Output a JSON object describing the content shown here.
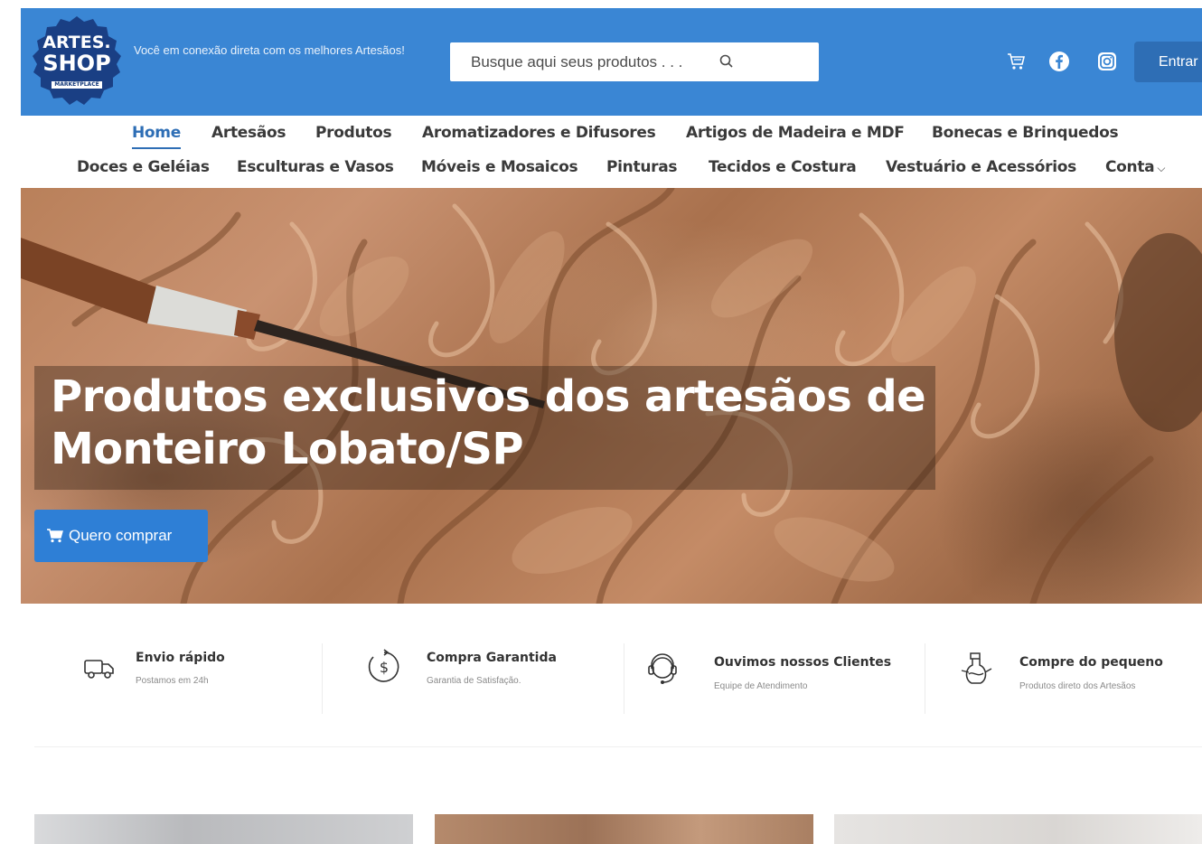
{
  "header": {
    "logo": {
      "line1": "ARTES.",
      "line2": "SHOP",
      "line3": "MARKETPLACE"
    },
    "tagline": "Você em conexão direta com os melhores Artesãos!",
    "search_placeholder": "Busque aqui seus produtos . . .",
    "login_label": "Entrar",
    "icons": [
      "cart-icon",
      "facebook-icon",
      "instagram-icon"
    ],
    "color": "#3a86d4"
  },
  "nav": {
    "row1": [
      "Home",
      "Artesãos",
      "Produtos",
      "Aromatizadores e Difusores",
      "Artigos de Madeira e MDF",
      "Bonecas e Brinquedos"
    ],
    "row2": [
      "Doces e Geléias",
      "Esculturas e Vasos",
      "Móveis e Mosaicos",
      "Pinturas",
      "Tecidos e Costura",
      "Vestuário e Acessórios",
      "Conta"
    ],
    "active": "Home",
    "accent": "#2e6eb5"
  },
  "hero": {
    "title": "Produtos exclusivos dos artesãos de Monteiro Lobato/SP",
    "cta_label": "Quero comprar",
    "cta_icon": "cart-icon"
  },
  "features": [
    {
      "title": "Envio rápido",
      "subtitle": "Postamos em 24h",
      "icon": "truck-icon"
    },
    {
      "title": "Compra Garantida",
      "subtitle": "Garantia de Satisfação.",
      "icon": "dollar-refresh-icon"
    },
    {
      "title": "Ouvimos nossos Clientes",
      "subtitle": "Equipe de Atendimento",
      "icon": "headset-icon"
    },
    {
      "title": "Compre do pequeno",
      "subtitle": "Produtos direto dos Artesãos",
      "icon": "craft-pot-icon"
    }
  ]
}
